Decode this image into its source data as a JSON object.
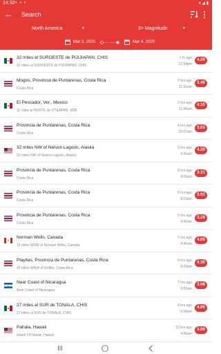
{
  "status_bar": {
    "time": "14:32",
    "dots": "• • •",
    "right": "▾ ◢ ▮"
  },
  "app_bar": {
    "title": "Search"
  },
  "filters": {
    "region": "North America",
    "magnitude": "3+ Magnitude"
  },
  "date_range": {
    "start": "Mar 3, 2025",
    "end": "Mar 4, 2025"
  },
  "colors": {
    "accent": "#e53935",
    "badge": "#e53935"
  },
  "events": [
    {
      "flag": "mexico",
      "place": "32 miles al SUROESTE de  PIJIJIAPAN, CHIS",
      "sub": "32 miles al SUROESTE de  PIJIJIAPAN, CHIS",
      "ago": "1 hr ago",
      "time": "12:34pm",
      "magnitude": "4.20"
    },
    {
      "flag": "costa-rica",
      "place": "Mogos, Provincia de Puntarenas, Costa Rica",
      "sub": "Costa Rica",
      "ago": "2 hrs ago",
      "time": "11:51am",
      "magnitude": "3.40"
    },
    {
      "flag": "mexico",
      "place": "El Pescador, Ver., Mexico",
      "sub": "11 miles al NORTE de  OTEAPAN, VER",
      "ago": "2 hrs ago",
      "time": "11:36am",
      "magnitude": "4.10"
    },
    {
      "flag": "costa-rica",
      "place": "Provincia de Puntarenas, Costa Rica",
      "sub": "Costa Rica",
      "ago": "4 hrs ago",
      "time": "10:07am",
      "magnitude": "3.03"
    },
    {
      "flag": "usa",
      "place": "32 miles NW of Nelson Lagoon, Alaska",
      "sub": "32 miles NW of Nelson Lagoon, Alaska",
      "ago": "5 hrs ago",
      "time": "9:36am",
      "magnitude": "4.20"
    },
    {
      "flag": "costa-rica",
      "place": "Provincia de Puntarenas, Costa Rica",
      "sub": "Costa Rica",
      "ago": "5 hrs ago",
      "time": "9:06am",
      "magnitude": "3.31"
    },
    {
      "flag": "costa-rica",
      "place": "Provincia de Puntarenas, Costa Rica",
      "sub": "Costa Rica",
      "ago": "5 hrs ago",
      "time": "8:53am",
      "magnitude": "3.02"
    },
    {
      "flag": "costa-rica",
      "place": "Provincia de Puntarenas, Costa Rica",
      "sub": "Costa Rica",
      "ago": "5 hrs ago",
      "time": "8:42am",
      "magnitude": "3.28"
    },
    {
      "flag": "canada",
      "place": "Norman Wells, Canada",
      "sub": "12 miles WSW of Norman Wells, Canada",
      "ago": "5 hrs ago",
      "time": "8:40am",
      "magnitude": "4.00"
    },
    {
      "flag": "costa-rica",
      "place": "Playitas, Provincia de Puntarenas, Costa Rica",
      "sub": "15 miles WNW of Golfito, Costa Rica",
      "ago": "6 hrs ago",
      "time": "8:29am",
      "magnitude": "4.30"
    },
    {
      "flag": "nicaragua",
      "place": "Near Coast of Nicaragua",
      "sub": "Near Coast of Nicaragua",
      "ago": "7 hrs ago",
      "time": "6:55am",
      "magnitude": "3.06"
    },
    {
      "flag": "mexico",
      "place": "27 miles al SUR de  TONALA, CHIS",
      "sub": "27 miles al SUR de  TONALA, CHIS",
      "ago": "8 hrs ago",
      "time": "6:28am",
      "magnitude": "4.00"
    },
    {
      "flag": "usa",
      "place": "Pahala, Hawaii",
      "sub": "Island Of Hawaii, Hawaii",
      "ago": "10 hrs ago",
      "time": "4:06am",
      "magnitude": "3.00"
    }
  ]
}
